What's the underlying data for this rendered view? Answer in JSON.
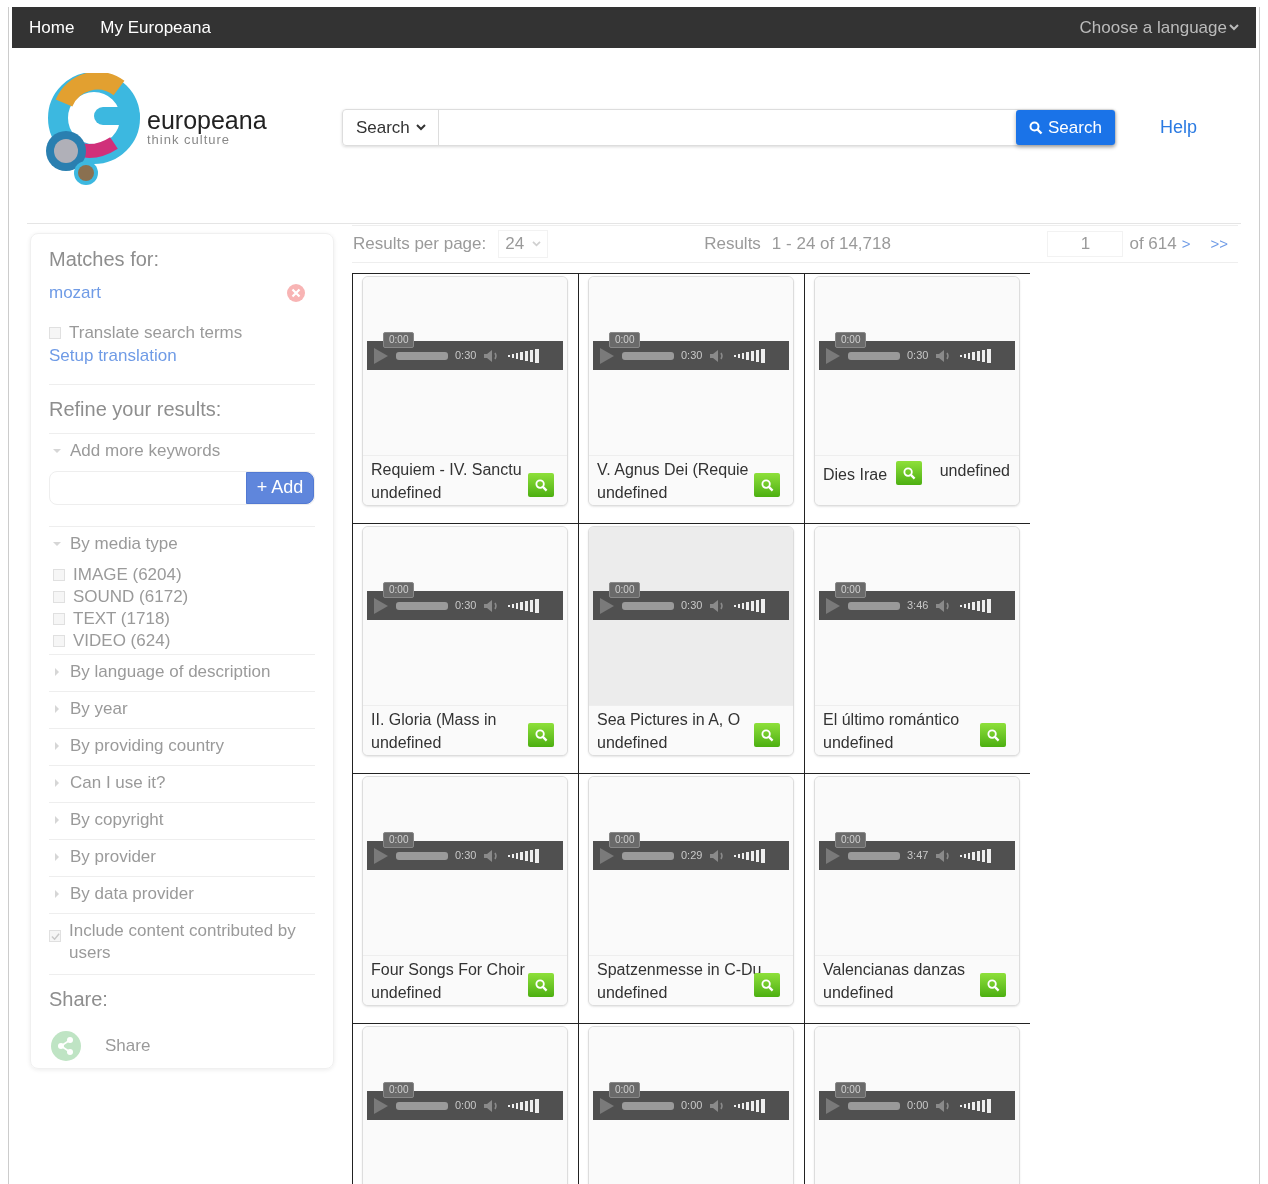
{
  "nav": {
    "links": [
      "Home",
      "My Europeana"
    ],
    "language": "Choose a language"
  },
  "logo": {
    "name": "europeana",
    "tagline": "think culture"
  },
  "search": {
    "scope": "Search",
    "button": "Search",
    "help": "Help"
  },
  "sidebar": {
    "matches_title": "Matches for:",
    "term": "mozart",
    "translate": {
      "label": "Translate search terms",
      "checked": false
    },
    "setup": "Setup translation",
    "refine_title": "Refine your results:",
    "keywords": {
      "label": "Add more keywords",
      "expanded": true,
      "button": "+ Add"
    },
    "facets": [
      {
        "label": "By media type",
        "expanded": true,
        "options": [
          {
            "label": "IMAGE (6204)",
            "checked": false
          },
          {
            "label": "SOUND (6172)",
            "checked": false
          },
          {
            "label": "TEXT (1718)",
            "checked": false
          },
          {
            "label": "VIDEO (624)",
            "checked": false
          }
        ]
      },
      {
        "label": "By language of description",
        "expanded": false
      },
      {
        "label": "By year",
        "expanded": false
      },
      {
        "label": "By providing country",
        "expanded": false
      },
      {
        "label": "Can I use it?",
        "expanded": false
      },
      {
        "label": "By copyright",
        "expanded": false
      },
      {
        "label": "By provider",
        "expanded": false
      },
      {
        "label": "By data provider",
        "expanded": false
      }
    ],
    "ugc": {
      "label": "Include content contributed by users",
      "checked": true
    },
    "share_title": "Share:",
    "share": "Share"
  },
  "results_bar": {
    "per_page_label": "Results per page:",
    "per_page": "24",
    "results_label": "Results",
    "range": "1 - 24 of 14,718",
    "page": "1",
    "of_pages": "of 614",
    "next": ">",
    "last": ">>"
  },
  "results": [
    {
      "title": "Requiem - IV. Sanctu",
      "subtitle": "undefined",
      "time": "0:00",
      "duration": "0:30",
      "kind": "stacked",
      "highlighted": false
    },
    {
      "title": "V. Agnus Dei (Requie",
      "subtitle": "undefined",
      "time": "0:00",
      "duration": "0:30",
      "kind": "stacked",
      "highlighted": false
    },
    {
      "title": "Dies Irae",
      "subtitle": "undefined",
      "time": "0:00",
      "duration": "0:30",
      "kind": "inline",
      "highlighted": false
    },
    {
      "title": "II. Gloria (Mass in",
      "subtitle": "undefined",
      "time": "0:00",
      "duration": "0:30",
      "kind": "stacked",
      "highlighted": false
    },
    {
      "title": "Sea Pictures in A, O",
      "subtitle": "undefined",
      "time": "0:00",
      "duration": "0:30",
      "kind": "stacked",
      "highlighted": true
    },
    {
      "title": "El último romántico",
      "subtitle": "undefined",
      "time": "0:00",
      "duration": "3:46",
      "kind": "stacked",
      "highlighted": false
    },
    {
      "title": "Four Songs For Choir",
      "subtitle": "undefined",
      "time": "0:00",
      "duration": "0:30",
      "kind": "stacked",
      "highlighted": false
    },
    {
      "title": "Spatzenmesse in C-Du",
      "subtitle": "undefined",
      "time": "0:00",
      "duration": "0:29",
      "kind": "stacked",
      "highlighted": false
    },
    {
      "title": "Valencianas danzas",
      "subtitle": "undefined",
      "time": "0:00",
      "duration": "3:47",
      "kind": "stacked",
      "highlighted": false
    },
    {
      "time": "0:00",
      "duration": "0:00",
      "kind": "cut",
      "highlighted": false
    },
    {
      "time": "0:00",
      "duration": "0:00",
      "kind": "cut",
      "highlighted": false
    },
    {
      "time": "0:00",
      "duration": "0:00",
      "kind": "cut",
      "highlighted": false
    }
  ]
}
